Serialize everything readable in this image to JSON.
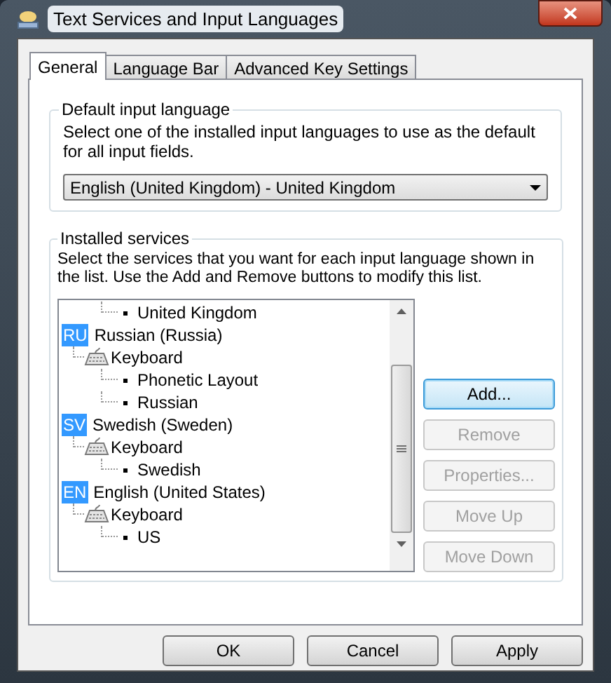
{
  "window": {
    "title": "Text Services and Input Languages"
  },
  "tabs": [
    {
      "label": "General",
      "selected": true
    },
    {
      "label": "Language Bar",
      "selected": false
    },
    {
      "label": "Advanced Key Settings",
      "selected": false
    }
  ],
  "default_language": {
    "legend": "Default input language",
    "description": "Select one of the installed input languages to use as the default for all input fields.",
    "value": "English (United Kingdom) - United Kingdom"
  },
  "installed_services": {
    "legend": "Installed services",
    "description": "Select the services that you want for each input language shown in the list. Use the Add and Remove buttons to modify this list.",
    "tree": [
      {
        "kind": "layout",
        "label": "United Kingdom"
      },
      {
        "kind": "language",
        "badge": "RU",
        "label": "Russian (Russia)",
        "children": [
          {
            "kind": "keyboard",
            "label": "Keyboard",
            "children": [
              {
                "kind": "layout",
                "label": "Phonetic Layout"
              },
              {
                "kind": "layout",
                "label": "Russian"
              }
            ]
          }
        ]
      },
      {
        "kind": "language",
        "badge": "SV",
        "label": "Swedish (Sweden)",
        "children": [
          {
            "kind": "keyboard",
            "label": "Keyboard",
            "children": [
              {
                "kind": "layout",
                "label": "Swedish"
              }
            ]
          }
        ]
      },
      {
        "kind": "language",
        "badge": "EN",
        "label": "English (United States)",
        "children": [
          {
            "kind": "keyboard",
            "label": "Keyboard",
            "children": [
              {
                "kind": "layout",
                "label": "US"
              }
            ]
          }
        ]
      }
    ],
    "buttons": [
      {
        "label": "Add...",
        "disabled": false,
        "focused": true
      },
      {
        "label": "Remove",
        "disabled": true,
        "focused": false
      },
      {
        "label": "Properties...",
        "disabled": true,
        "focused": false
      },
      {
        "label": "Move Up",
        "disabled": true,
        "focused": false
      },
      {
        "label": "Move Down",
        "disabled": true,
        "focused": false
      }
    ]
  },
  "dialog_buttons": [
    "OK",
    "Cancel",
    "Apply"
  ]
}
